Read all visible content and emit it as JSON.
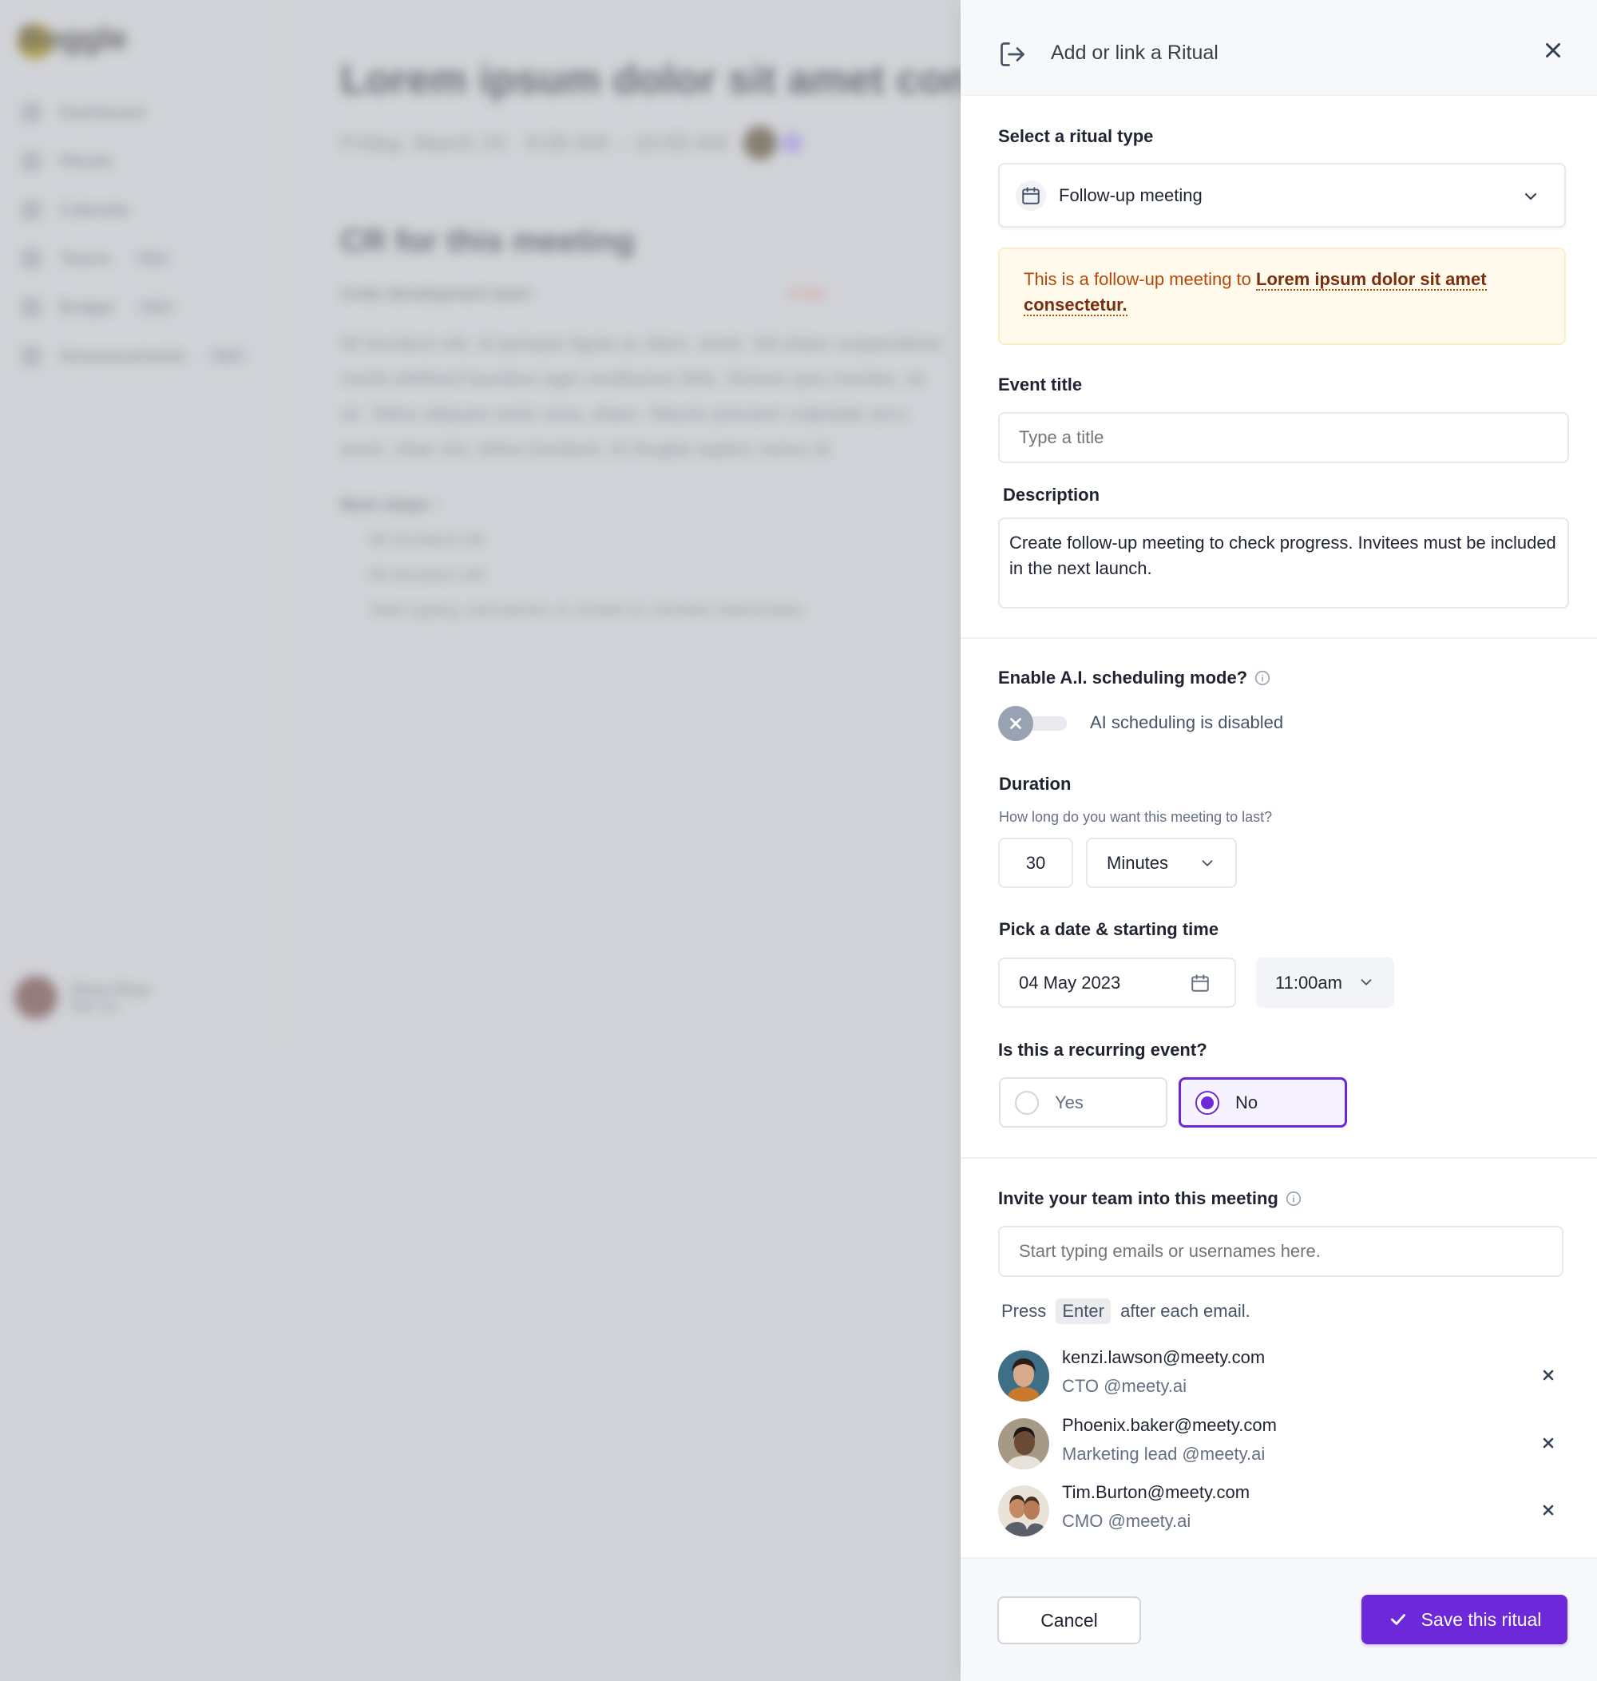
{
  "background": {
    "logo": "Boggle",
    "nav": [
      {
        "label": "Dashboard",
        "badge": ""
      },
      {
        "label": "Rituals",
        "badge": ""
      },
      {
        "label": "Calendar",
        "badge": ""
      },
      {
        "label": "Teams",
        "badge": "New"
      },
      {
        "label": "Budget",
        "badge": "New"
      },
      {
        "label": "Announcements",
        "badge": "New"
      }
    ],
    "user_name": "Olivia Rhye",
    "user_sub": "Sign Out",
    "page_title": "Lorem ipsum dolor sit amet consectetur",
    "page_subtitle": "Friday, March 24 · 9:00 AM – 10:00 AM",
    "cr_heading": "CR for this meeting",
    "cr_row": "Invite development team",
    "cr_row_badge": "4 Hrs",
    "paragraph": "Mi tincidunt elit, id quisque ligula ac diam, amet. Vel etiam suspendisse morbi eleifend faucibus eget vestibulum felis. Dictum quis montes, sit sit. Tellus aliquam enim urna, etiam. Mauris posuere vulputate arcu amet, vitae nisi, tellus tincidunt. At feugiat sapien varius id.",
    "next_steps": "Next steps :",
    "list": [
      "Mi tincidunt elit",
      "Mi tincidunt elit",
      "Start typing usernames or emails to mention teammates"
    ]
  },
  "drawer": {
    "title": "Add or link a Ritual",
    "ritual_type": {
      "label": "Select a ritual type",
      "value": "Follow-up meeting"
    },
    "notice": {
      "prefix": "This is a follow-up meeting to ",
      "link": "Lorem ipsum dolor sit amet consectetur."
    },
    "event_title": {
      "label": "Event title",
      "placeholder": "Type a title",
      "value": ""
    },
    "description": {
      "label": "Description",
      "value": "Create follow-up meeting to check progress. Invitees must be included in the next launch."
    },
    "ai_scheduling": {
      "label": "Enable A.I. scheduling mode?",
      "enabled": false,
      "status": "AI scheduling is disabled"
    },
    "duration": {
      "label": "Duration",
      "hint": "How long do you want this meeting to last?",
      "value": "30",
      "unit": "Minutes"
    },
    "datetime": {
      "label": "Pick a date & starting time",
      "date": "04 May 2023",
      "time": "11:00am"
    },
    "recurring": {
      "label": "Is this a recurring event?",
      "options": [
        "Yes",
        "No"
      ],
      "selected": "No"
    },
    "invite": {
      "label": "Invite your team into this meeting",
      "placeholder": "Start typing emails or usernames here.",
      "hint_prefix": "Press",
      "hint_key": "Enter",
      "hint_suffix": "after each email.",
      "invitees": [
        {
          "email": "kenzi.lawson@meety.com",
          "role": "CTO @meety.ai"
        },
        {
          "email": "Phoenix.baker@meety.com",
          "role": "Marketing lead @meety.ai"
        },
        {
          "email": "Tim.Burton@meety.com",
          "role": "CMO @meety.ai"
        }
      ]
    },
    "footer": {
      "cancel": "Cancel",
      "save": "Save this ritual"
    }
  },
  "colors": {
    "accent": "#6d28d9",
    "notice_bg": "#fffaeb",
    "notice_text": "#b54708"
  }
}
